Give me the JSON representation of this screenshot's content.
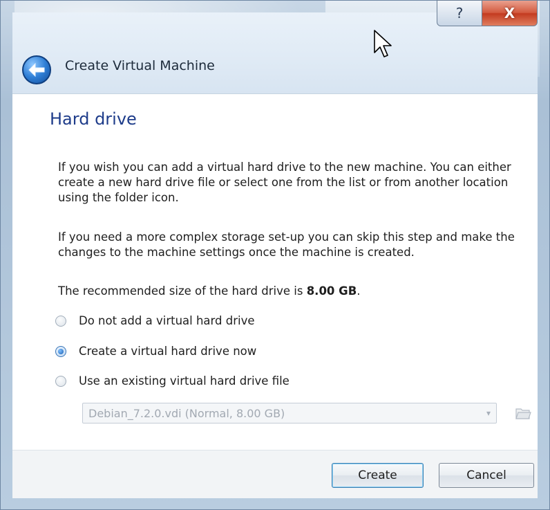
{
  "window": {
    "title": "Create Virtual Machine",
    "help_label": "?",
    "close_label": "X"
  },
  "page": {
    "title": "Hard drive",
    "paragraph1": "If you wish you can add a virtual hard drive to the new machine. You can either create a new hard drive file or select one from the list or from another location using the folder icon.",
    "paragraph2": "If you need a more complex storage set-up you can skip this step and make the changes to the machine settings once the machine is created.",
    "recommended_prefix": "The recommended size of the hard drive is ",
    "recommended_size": "8.00 GB",
    "recommended_suffix": "."
  },
  "options": [
    {
      "label": "Do not add a virtual hard drive",
      "checked": false
    },
    {
      "label": "Create a virtual hard drive now",
      "checked": true
    },
    {
      "label": "Use an existing virtual hard drive file",
      "checked": false
    }
  ],
  "existing_file": {
    "selected": "Debian_7.2.0.vdi (Normal, 8.00 GB)",
    "enabled": false
  },
  "buttons": {
    "create": "Create",
    "cancel": "Cancel"
  },
  "icons": {
    "back": "back-arrow-icon",
    "folder": "folder-icon",
    "cursor": "mouse-pointer-icon"
  },
  "colors": {
    "title_blue": "#1e3c8a",
    "back_button": "#2f7fd6",
    "close_red": "#c33b20"
  }
}
